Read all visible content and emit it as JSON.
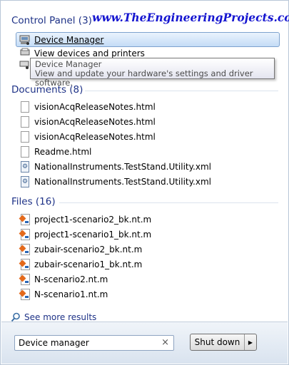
{
  "sections": {
    "control_panel": {
      "header": "Control Panel (3)",
      "items": [
        {
          "label": "Device Manager"
        },
        {
          "label": "View devices and printers"
        }
      ],
      "tooltip": {
        "title": "Device Manager",
        "description": "View and update your hardware's settings and driver software."
      }
    },
    "documents": {
      "header": "Documents (8)",
      "items": [
        {
          "label": "visionAcqReleaseNotes.html"
        },
        {
          "label": "visionAcqReleaseNotes.html"
        },
        {
          "label": "visionAcqReleaseNotes.html"
        },
        {
          "label": "Readme.html"
        },
        {
          "label": "NationalInstruments.TestStand.Utility.xml"
        },
        {
          "label": "NationalInstruments.TestStand.Utility.xml"
        }
      ]
    },
    "files": {
      "header": "Files (16)",
      "items": [
        {
          "label": "project1-scenario2_bk.nt.m"
        },
        {
          "label": "project1-scenario1_bk.nt.m"
        },
        {
          "label": "zubair-scenario2_bk.nt.m"
        },
        {
          "label": "zubair-scenario1_bk.nt.m"
        },
        {
          "label": "N-scenario2.nt.m"
        },
        {
          "label": "N-scenario1.nt.m"
        }
      ]
    }
  },
  "see_more": "See more results",
  "search": {
    "value": "Device manager",
    "clear_glyph": "×"
  },
  "shutdown": {
    "label": "Shut down",
    "arrow_glyph": "▶"
  },
  "watermark": "www.TheEngineeringProjects.com",
  "colors": {
    "header_text": "#1e3287",
    "selection_border": "#7da2ce",
    "watermark": "#1515d0"
  }
}
